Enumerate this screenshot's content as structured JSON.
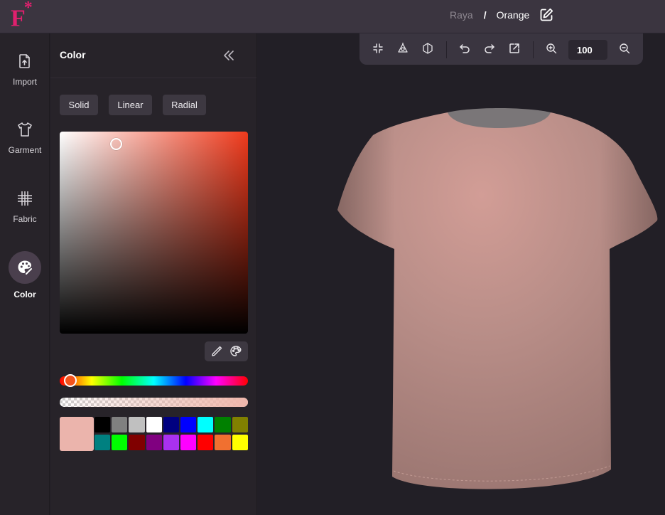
{
  "app": {
    "logo_text": "F",
    "logo_mark": "*",
    "brand_color": "#e0206e"
  },
  "breadcrumb": {
    "parent": "Raya",
    "separator": "/",
    "current": "Orange",
    "edit_icon": "edit-square-icon"
  },
  "rail": {
    "items": [
      {
        "label": "Import",
        "icon": "file-upload-icon",
        "active": false
      },
      {
        "label": "Garment",
        "icon": "tshirt-icon",
        "active": false
      },
      {
        "label": "Fabric",
        "icon": "fabric-grid-icon",
        "active": false
      },
      {
        "label": "Color",
        "icon": "palette-icon",
        "active": true
      }
    ]
  },
  "color_panel": {
    "title": "Color",
    "collapse_icon": "double-chevron-left-icon",
    "modes": [
      "Solid",
      "Linear",
      "Radial"
    ],
    "picker": {
      "base_hue_color": "#f03a1c",
      "saturation": 0.3,
      "value": 0.94,
      "hue": 0.03,
      "alpha": 1
    },
    "tools": [
      "eyedropper-icon",
      "palette-icon"
    ],
    "current_color": "#ebb4ac",
    "swatches": [
      "#000000",
      "#808080",
      "#c0c0c0",
      "#ffffff",
      "#000080",
      "#0000ff",
      "#00ffff",
      "#008000",
      "#808000",
      "#008080",
      "#00ff00",
      "#800000",
      "#800080",
      "#a931f0",
      "#ff00ff",
      "#ff0000",
      "#f07030",
      "#ffff00"
    ]
  },
  "viewport_toolbar": {
    "buttons": [
      "fit-view-icon",
      "center-model-icon",
      "3d-view-icon",
      "undo-icon",
      "redo-icon",
      "export-icon",
      "zoom-in-icon",
      "zoom-out-icon"
    ],
    "zoom_value": "100"
  },
  "model": {
    "garment": "t-shirt",
    "fabric_color": "#b98e88",
    "collar_color": "#7a7678"
  }
}
